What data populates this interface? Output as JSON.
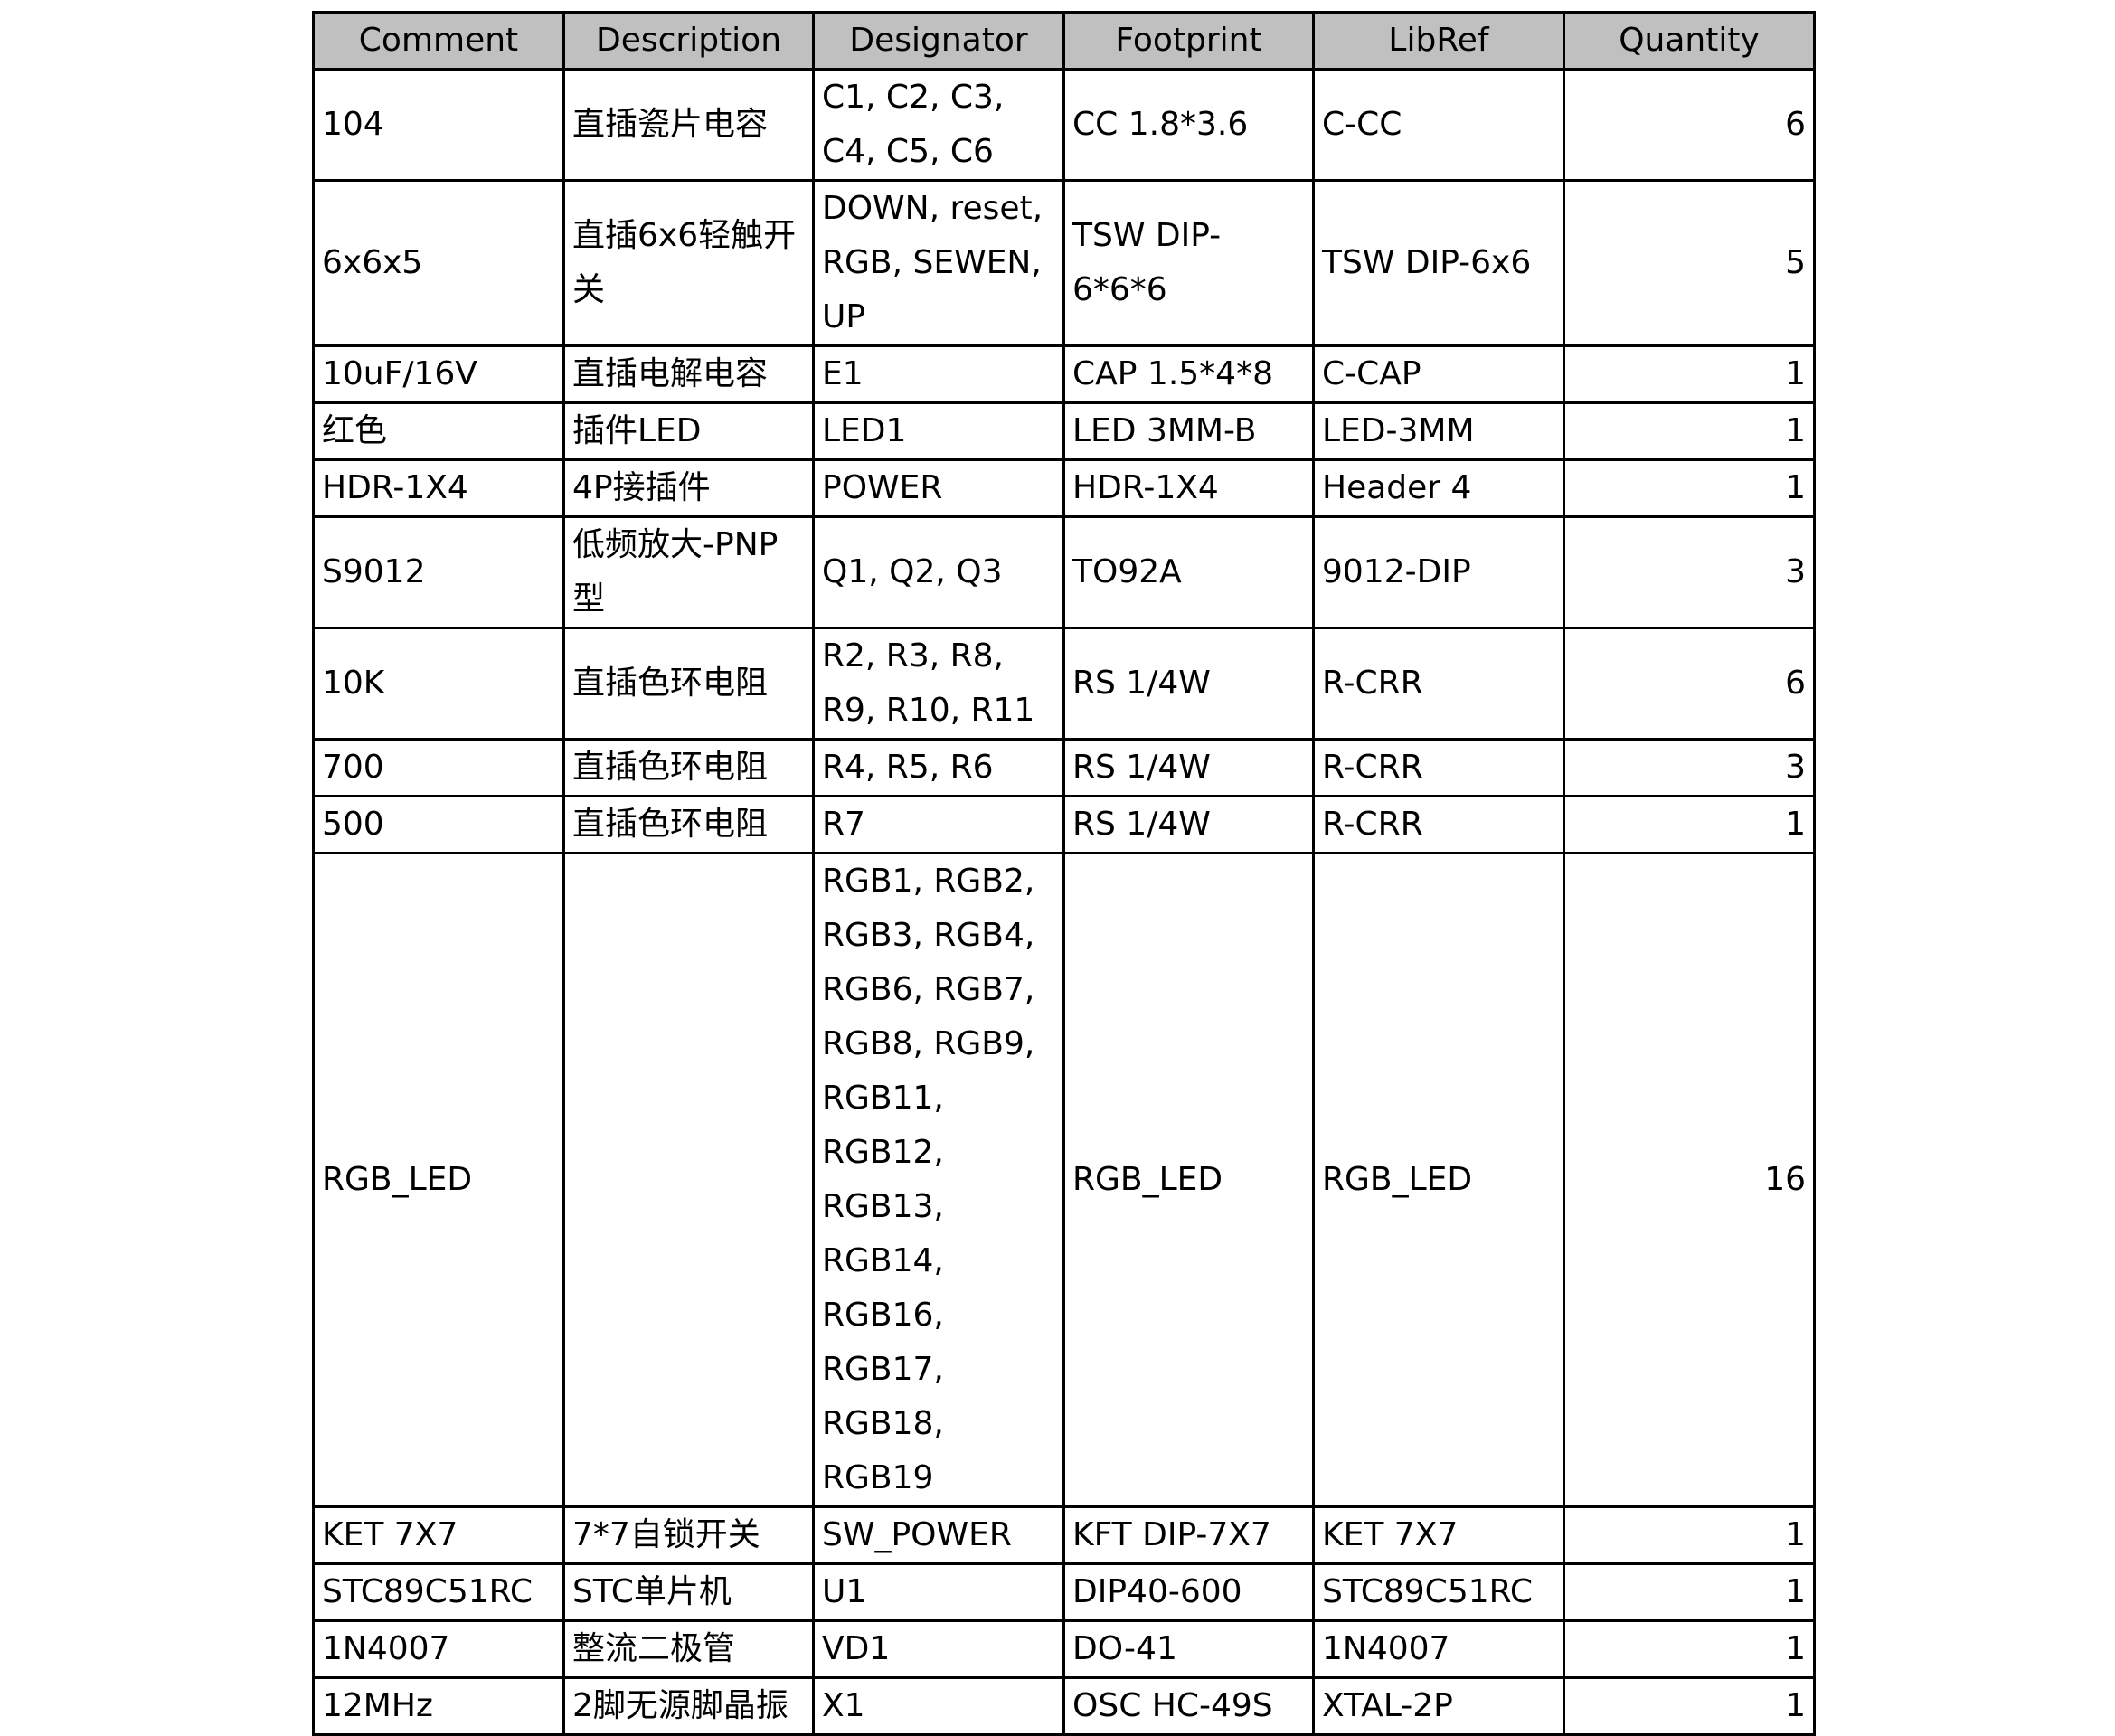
{
  "table": {
    "headers": [
      "Comment",
      "Description",
      "Designator",
      "Footprint",
      "LibRef",
      "Quantity"
    ],
    "rows": [
      [
        "104",
        "直插瓷片电容",
        "C1, C2, C3, C4, C5, C6",
        "CC 1.8*3.6",
        "C-CC",
        "6"
      ],
      [
        "6x6x5",
        "直插6x6轻触开关",
        "DOWN, reset, RGB, SEWEN, UP",
        "TSW DIP-6*6*6",
        "TSW DIP-6x6",
        "5"
      ],
      [
        "10uF/16V",
        "直插电解电容",
        "E1",
        "CAP 1.5*4*8",
        "C-CAP",
        "1"
      ],
      [
        "红色",
        "插件LED",
        "LED1",
        "LED 3MM-B",
        "LED-3MM",
        "1"
      ],
      [
        "HDR-1X4",
        "4P接插件",
        "POWER",
        "HDR-1X4",
        "Header 4",
        "1"
      ],
      [
        "S9012",
        "低频放大-PNP型",
        "Q1, Q2, Q3",
        "TO92A",
        "9012-DIP",
        "3"
      ],
      [
        "10K",
        "直插色环电阻",
        "R2, R3, R8, R9, R10, R11",
        "RS 1/4W",
        "R-CRR",
        "6"
      ],
      [
        "700",
        "直插色环电阻",
        "R4, R5, R6",
        "RS 1/4W",
        "R-CRR",
        "3"
      ],
      [
        "500",
        "直插色环电阻",
        "R7",
        "RS 1/4W",
        "R-CRR",
        "1"
      ],
      [
        "RGB_LED",
        "",
        "RGB1, RGB2, RGB3, RGB4, RGB6, RGB7, RGB8, RGB9, RGB11, RGB12, RGB13, RGB14, RGB16, RGB17, RGB18, RGB19",
        "RGB_LED",
        "RGB_LED",
        "16"
      ],
      [
        "KET 7X7",
        "7*7自锁开关",
        "SW_POWER",
        "KFT DIP-7X7",
        "KET 7X7",
        "1"
      ],
      [
        "STC89C51RC",
        "STC单片机",
        "U1",
        "DIP40-600",
        "STC89C51RC",
        "1"
      ],
      [
        "1N4007",
        "整流二极管",
        "VD1",
        "DO-41",
        "1N4007",
        "1"
      ],
      [
        "12MHz",
        "2脚无源脚晶振",
        "X1",
        "OSC HC-49S",
        "XTAL-2P",
        "1"
      ]
    ]
  },
  "colors": {
    "header_background": "#c0c0c0",
    "border": "#000000"
  }
}
